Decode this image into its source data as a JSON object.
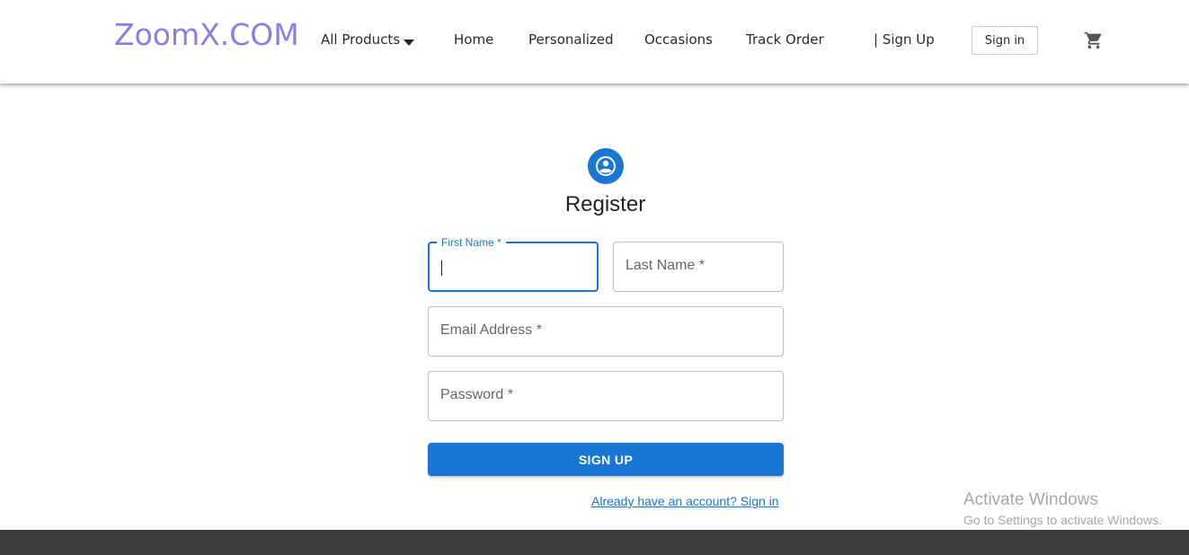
{
  "brand": {
    "logo_text": "ZoomX.COM",
    "color": "#8f7de6"
  },
  "nav": {
    "all_products": "All Products",
    "home": "Home",
    "personalized": "Personalized",
    "occasions": "Occasions",
    "track_order": "Track Order",
    "sign_up": "| Sign Up",
    "sign_in": "Sign in",
    "cart_icon": "shopping-cart-icon",
    "dropdown_icon": "caret-down-icon"
  },
  "form": {
    "avatar_icon": "account-circle-icon",
    "title": "Register",
    "first_name_label": "First Name *",
    "first_name_value": "",
    "last_name_label": "Last Name *",
    "email_label": "Email Address *",
    "password_label": "Password *",
    "submit_label": "SIGN UP",
    "signin_link": "Already have an account? Sign in",
    "accent_color": "#1976d2"
  },
  "watermark": {
    "title": "Activate Windows",
    "subtitle": "Go to Settings to activate Windows."
  }
}
